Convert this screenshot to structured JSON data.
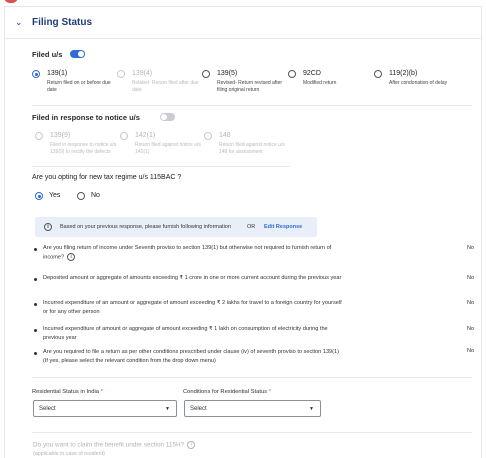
{
  "section": {
    "title": "Filing Status"
  },
  "filed_us": {
    "label": "Filed u/s",
    "toggle_on": true,
    "options": [
      {
        "title": "139(1)",
        "desc": "Return filed on or before due date",
        "selected": true,
        "disabled": false
      },
      {
        "title": "139(4)",
        "desc": "Belated- Return filed after due date",
        "selected": false,
        "disabled": true
      },
      {
        "title": "139(5)",
        "desc": "Revised- Return revised after filing original return",
        "selected": false,
        "disabled": false
      },
      {
        "title": "92CD",
        "desc": "Modified return",
        "selected": false,
        "disabled": false
      },
      {
        "title": "119(2)(b)",
        "desc": "After condonation of delay",
        "selected": false,
        "disabled": false
      }
    ]
  },
  "notice": {
    "label": "Filed in response to notice u/s",
    "toggle_on": false,
    "options": [
      {
        "title": "139(9)",
        "desc": "Filed in response to notice u/s 139(9) to rectify the defects"
      },
      {
        "title": "142(1)",
        "desc": "Return filed against notice u/s 142(1)"
      },
      {
        "title": "148",
        "desc": "Return filed against notice u/s 148 for assessment"
      }
    ]
  },
  "regime": {
    "question": "Are you opting for new tax regime u/s 115BAC ?",
    "yes_label": "Yes",
    "no_label": "No",
    "selected": "Yes"
  },
  "info": {
    "text": "Based on your previous response, please furnish following information",
    "or": "OR",
    "link": "Edit Response"
  },
  "questions": [
    {
      "text": "Are you filing return of income under Seventh proviso to section 139(1) but otherwise not required to furnish return of income?",
      "answer": "No",
      "help": true
    },
    {
      "text": "Deposited amount or aggregate of amounts exceeding ₹ 1 crore in one or more current account during the previous year",
      "answer": "No",
      "help": false
    },
    {
      "text": "Incurred expenditure of an amount or aggregate of amount exceeding ₹ 2 lakhs for travel to a foreign country for yourself or for any other person",
      "answer": "No",
      "help": false
    },
    {
      "text": "Incurred expenditure of amount or aggregate of amount exceeding ₹ 1 lakh on consumption of electricity during the previous year",
      "answer": "No",
      "help": false
    },
    {
      "text": "Are you required to file a return as per other conditions prescribed under clause (iv) of seventh proviso to section 139(1) (If yes, please select the relevant condition from the drop down menu)",
      "answer": "No",
      "help": false
    }
  ],
  "residential": {
    "label": "Residential Status in India",
    "required_mark": "*",
    "value": "Select"
  },
  "conditions": {
    "label": "Conditions for Residential Status",
    "required_mark": "*",
    "value": "Select"
  },
  "section115h": {
    "question": "Do you want to claim the benefit under section 115H?",
    "sub": "(applicable in case of resident)"
  },
  "icons": {
    "chevron": "chevron-down-icon",
    "info": "info-icon",
    "help": "help-icon",
    "caret": "caret-down-icon"
  },
  "colors": {
    "primary": "#2f6bd6",
    "heading": "#1f3d7a",
    "info_bg": "#e8eff9"
  }
}
